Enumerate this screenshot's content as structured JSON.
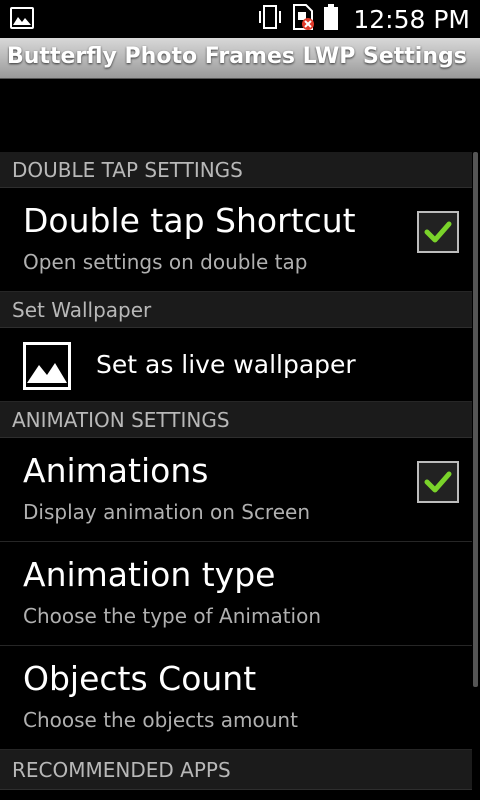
{
  "statusbar": {
    "time": "12:58 PM"
  },
  "app": {
    "title": "Butterfly Photo Frames LWP Settings"
  },
  "sections": {
    "double_tap": {
      "header": "DOUBLE TAP SETTINGS",
      "shortcut_title": "Double tap Shortcut",
      "shortcut_summary": "Open settings on double tap",
      "shortcut_checked": true
    },
    "wallpaper": {
      "header": "Set Wallpaper",
      "item_label": "Set as live wallpaper"
    },
    "animation": {
      "header": "ANIMATION SETTINGS",
      "animations_title": "Animations",
      "animations_summary": "Display animation on Screen",
      "animations_checked": true,
      "type_title": "Animation type",
      "type_summary": "Choose the type of Animation",
      "count_title": "Objects Count",
      "count_summary": "Choose the objects amount"
    },
    "recommended": {
      "header": "RECOMMENDED APPS"
    }
  },
  "colors": {
    "check": "#7ad32a",
    "title_bar": "#b0b0b0",
    "header_bg": "#1b1b1b"
  }
}
